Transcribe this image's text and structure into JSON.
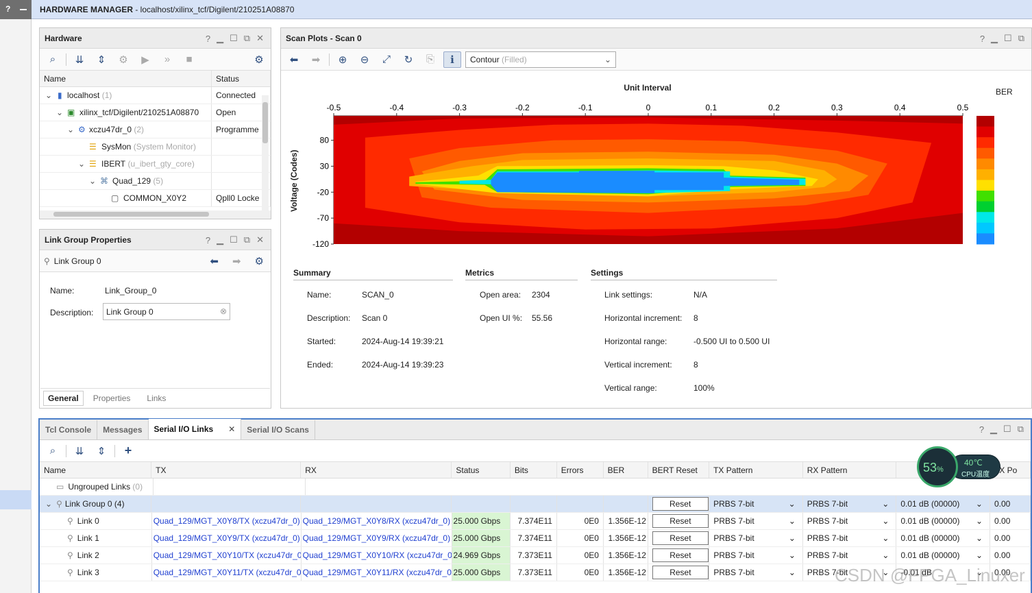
{
  "topbar": {
    "title": "HARDWARE MANAGER",
    "path": " - localhost/xilinx_tcf/Digilent/210251A08870",
    "help": "?"
  },
  "hardware": {
    "title": "Hardware",
    "columns": [
      "Name",
      "Status"
    ],
    "rows": [
      {
        "name": "localhost",
        "count": "(1)",
        "status": "Connected"
      },
      {
        "name": "xilinx_tcf/Digilent/210251A08870",
        "count": "",
        "status": "Open"
      },
      {
        "name": "xczu47dr_0",
        "count": "(2)",
        "status": "Programme"
      },
      {
        "name": "SysMon",
        "count": "(System Monitor)",
        "status": ""
      },
      {
        "name": "IBERT",
        "count": "(u_ibert_gty_core)",
        "status": ""
      },
      {
        "name": "Quad_129",
        "count": "(5)",
        "status": ""
      },
      {
        "name": "COMMON_X0Y2",
        "count": "",
        "status": "Qpll0 Locke"
      }
    ]
  },
  "linkgroup": {
    "title": "Link Group Properties",
    "item": "Link Group 0",
    "name_label": "Name:",
    "name_value": "Link_Group_0",
    "desc_label": "Description:",
    "desc_value": "Link Group 0",
    "tabs": [
      "General",
      "Properties",
      "Links"
    ]
  },
  "scan": {
    "title": "Scan Plots - Scan 0",
    "plot_type": "Contour",
    "plot_type_sub": "(Filled)",
    "xlabel": "Unit Interval",
    "ylabel": "Voltage (Codes)",
    "legend_title": "BER",
    "xticks": [
      "-0.5",
      "-0.4",
      "-0.3",
      "-0.2",
      "-0.1",
      "0",
      "0.1",
      "0.2",
      "0.3",
      "0.4",
      "0.5"
    ],
    "yticks": [
      "80",
      "30",
      "-20",
      "-70",
      "-120"
    ],
    "summary": {
      "head": "Summary",
      "name_l": "Name:",
      "name_v": "SCAN_0",
      "desc_l": "Description:",
      "desc_v": "Scan 0",
      "start_l": "Started:",
      "start_v": "2024-Aug-14 19:39:21",
      "end_l": "Ended:",
      "end_v": "2024-Aug-14 19:39:23"
    },
    "metrics": {
      "head": "Metrics",
      "area_l": "Open area:",
      "area_v": "2304",
      "ui_l": "Open UI %:",
      "ui_v": "55.56"
    },
    "settings": {
      "head": "Settings",
      "ls_l": "Link settings:",
      "ls_v": "N/A",
      "hi_l": "Horizontal increment:",
      "hi_v": "8",
      "hr_l": "Horizontal range:",
      "hr_v": "-0.500 UI to 0.500 UI",
      "vi_l": "Vertical increment:",
      "vi_v": "8",
      "vr_l": "Vertical range:",
      "vr_v": "100%"
    },
    "colors": [
      "#b30000",
      "#e00000",
      "#ff2a00",
      "#ff5a00",
      "#ff8a00",
      "#ffb000",
      "#ffe000",
      "#c8f000",
      "#40e000",
      "#00d030",
      "#00e8e8",
      "#00c8ff",
      "#1a8cff"
    ]
  },
  "bottom": {
    "tabs": [
      "Tcl Console",
      "Messages",
      "Serial I/O Links",
      "Serial I/O Scans"
    ],
    "columns": [
      "Name",
      "TX",
      "RX",
      "Status",
      "Bits",
      "Errors",
      "BER",
      "BERT Reset",
      "TX Pattern",
      "RX Pattern",
      "",
      "TX Po"
    ],
    "ungrouped": "Ungrouped Links",
    "ungrouped_count": "(0)",
    "group": "Link Group 0",
    "group_count": "(4)",
    "group_reset": "Reset",
    "group_txp": "PRBS 7-bit",
    "group_rxp": "PRBS 7-bit",
    "group_db": "0.01 dB (00000)",
    "group_txpo": "0.00",
    "links": [
      {
        "name": "Link 0",
        "tx": "Quad_129/MGT_X0Y8/TX (xczu47dr_0)",
        "rx": "Quad_129/MGT_X0Y8/RX (xczu47dr_0)",
        "status": "25.000 Gbps",
        "bits": "7.374E11",
        "errors": "0E0",
        "ber": "1.356E-12",
        "reset": "Reset",
        "txp": "PRBS 7-bit",
        "rxp": "PRBS 7-bit",
        "db": "0.01 dB (00000)",
        "txpo": "0.00"
      },
      {
        "name": "Link 1",
        "tx": "Quad_129/MGT_X0Y9/TX (xczu47dr_0)",
        "rx": "Quad_129/MGT_X0Y9/RX (xczu47dr_0)",
        "status": "25.000 Gbps",
        "bits": "7.374E11",
        "errors": "0E0",
        "ber": "1.356E-12",
        "reset": "Reset",
        "txp": "PRBS 7-bit",
        "rxp": "PRBS 7-bit",
        "db": "0.01 dB (00000)",
        "txpo": "0.00"
      },
      {
        "name": "Link 2",
        "tx": "Quad_129/MGT_X0Y10/TX (xczu47dr_0)",
        "rx": "Quad_129/MGT_X0Y10/RX (xczu47dr_0)",
        "status": "24.969 Gbps",
        "bits": "7.373E11",
        "errors": "0E0",
        "ber": "1.356E-12",
        "reset": "Reset",
        "txp": "PRBS 7-bit",
        "rxp": "PRBS 7-bit",
        "db": "0.01 dB (00000)",
        "txpo": "0.00"
      },
      {
        "name": "Link 3",
        "tx": "Quad_129/MGT_X0Y11/TX (xczu47dr_0)",
        "rx": "Quad_129/MGT_X0Y11/RX (xczu47dr_0)",
        "status": "25.000 Gbps",
        "bits": "7.373E11",
        "errors": "0E0",
        "ber": "1.356E-12",
        "reset": "Reset",
        "txp": "PRBS 7-bit",
        "rxp": "PRBS 7-bit",
        "db": "-0.01 dB",
        "txpo": "0.00"
      }
    ]
  },
  "widget": {
    "cpu": "53",
    "cpu_unit": "%",
    "temp": "40℃",
    "temp_label": "CPU温度"
  },
  "watermark": "CSDN @FPGA_Linuxer"
}
